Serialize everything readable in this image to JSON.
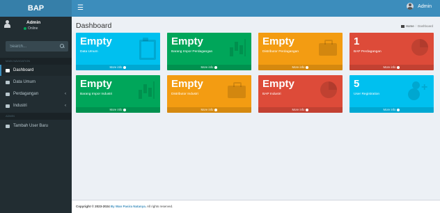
{
  "app": {
    "logo": "BAP"
  },
  "navbar": {
    "user_name": "Admin"
  },
  "sidebar": {
    "user": {
      "name": "Admin",
      "status": "Online"
    },
    "search_placeholder": "Search...",
    "main_header": "MAIN NAVIGATION",
    "menu": [
      {
        "label": "Dashboard",
        "active": true
      },
      {
        "label": "Data Umum"
      },
      {
        "label": "Perdagangan"
      },
      {
        "label": "Industri"
      }
    ],
    "admin_header": "ADMIN",
    "admin_menu": [
      {
        "label": "Tambah User Baru"
      }
    ]
  },
  "content": {
    "title": "Dashboard",
    "breadcrumb": {
      "home": "Home",
      "separator": "/",
      "current": "Dashboard"
    }
  },
  "boxes": [
    {
      "value": "Empty",
      "label": "Data Umum",
      "footer": "More info",
      "color": "#00c0ef",
      "icon": "clipboard-icon"
    },
    {
      "value": "Empty",
      "label": "Barang Impor Perdagangan",
      "footer": "More info",
      "color": "#00a65a",
      "icon": "bar-chart-icon"
    },
    {
      "value": "Empty",
      "label": "Distributor Perdagangan",
      "footer": "More info",
      "color": "#f39c12",
      "icon": "briefcase-icon"
    },
    {
      "value": "1",
      "label": "BAP Perdagangan",
      "footer": "More info",
      "color": "#dd4b39",
      "icon": "pie-chart-icon"
    },
    {
      "value": "Empty",
      "label": "Barang Impor Industri",
      "footer": "More info",
      "color": "#00a65a",
      "icon": "bar-chart-icon"
    },
    {
      "value": "Empty",
      "label": "Distributor Industri",
      "footer": "More info",
      "color": "#f39c12",
      "icon": "briefcase-icon"
    },
    {
      "value": "Empty",
      "label": "BAP Industri",
      "footer": "More info",
      "color": "#dd4b39",
      "icon": "pie-chart-icon"
    },
    {
      "value": "5",
      "label": "User Registration",
      "footer": "More info",
      "color": "#00c0ef",
      "icon": "user-add-icon"
    }
  ],
  "footer": {
    "copyright": "Copyright © 2023-2024",
    "by": "By Wan Pasira Natanya.",
    "rights": "All rights reserved."
  }
}
